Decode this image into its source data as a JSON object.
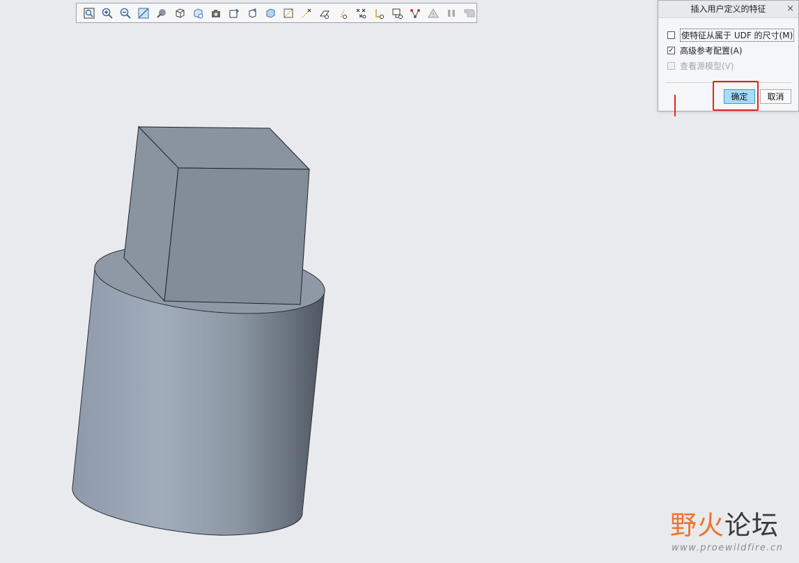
{
  "toolbar": {
    "icons": [
      "refit-icon",
      "zoom-in-icon",
      "zoom-out-icon",
      "repaint-icon",
      "shading-icon",
      "display-style-icon",
      "saved-views-icon",
      "view-manager-icon",
      "datum-planes-icon",
      "datum-axes-icon",
      "datum-points-icon",
      "coordinate-systems-icon",
      "annotations-icon",
      "spin-center-icon",
      "plane-tag-icon",
      "axis-tag-icon",
      "point-tag-icon",
      "csys-tag-icon",
      "view-orientation-icon",
      "network-icon",
      "warning-icon",
      "pause-icon",
      "stop-icon"
    ]
  },
  "dialog": {
    "title": "插入用户定义的特征",
    "close": "×",
    "options": [
      {
        "label": "使特征从属于 UDF 的尺寸(M)",
        "checked": false,
        "enabled": true
      },
      {
        "label": "高级参考配置(A)",
        "checked": true,
        "enabled": true
      },
      {
        "label": "查看源模型(V)",
        "checked": false,
        "enabled": false
      }
    ],
    "ok_label": "确定",
    "cancel_label": "取消"
  },
  "watermark": {
    "logo_part1": "野",
    "logo_part2": "火",
    "logo_part3": "论坛",
    "url": "www.proewildfire.cn"
  },
  "colors": {
    "background": "#e9eaee",
    "highlight": "#e8221c",
    "ok_button": "#a8dcf5",
    "model_face": "#8f99a6"
  }
}
